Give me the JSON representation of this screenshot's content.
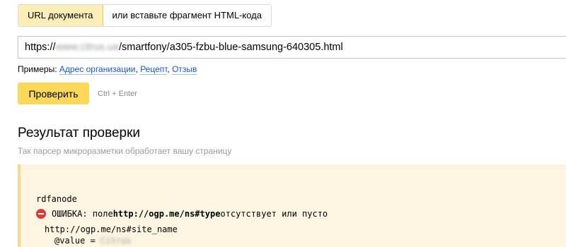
{
  "tabs": [
    {
      "label": "URL документа",
      "active": true
    },
    {
      "label": "или вставьте фрагмент HTML-кода",
      "active": false
    }
  ],
  "url_input": {
    "prefix": "https://",
    "domain_blurred": "www.citrus.ua",
    "path": "/smartfony/a305-fzbu-blue-samsung-640305.html"
  },
  "examples": {
    "label": "Примеры:",
    "links": [
      "Адрес организации",
      "Рецепт",
      "Отзыв"
    ],
    "separator": ", "
  },
  "check_button": {
    "label": "Проверить",
    "shortcut": "Ctrl + Enter"
  },
  "result": {
    "title": "Результат проверки",
    "subtitle": "Так парсер микроразметки обработает вашу страницу",
    "lines": {
      "node": "rdfanode",
      "error_prefix": "ОШИБКА: поле ",
      "error_field": "http://ogp.me/ns#type",
      "error_suffix": " отсутствует или пусто",
      "site_name": "http://ogp.me/ns#site_name",
      "value_key": "@value = ",
      "value_blurred": "Citrus"
    }
  },
  "colors": {
    "tab_active_bg": "#fdeeb8",
    "button_bg": "#fcd85a",
    "link": "#1a55c4",
    "panel_bg": "#fdf5e1",
    "panel_border": "#f6d88a",
    "error_icon": "#d83a3a"
  }
}
